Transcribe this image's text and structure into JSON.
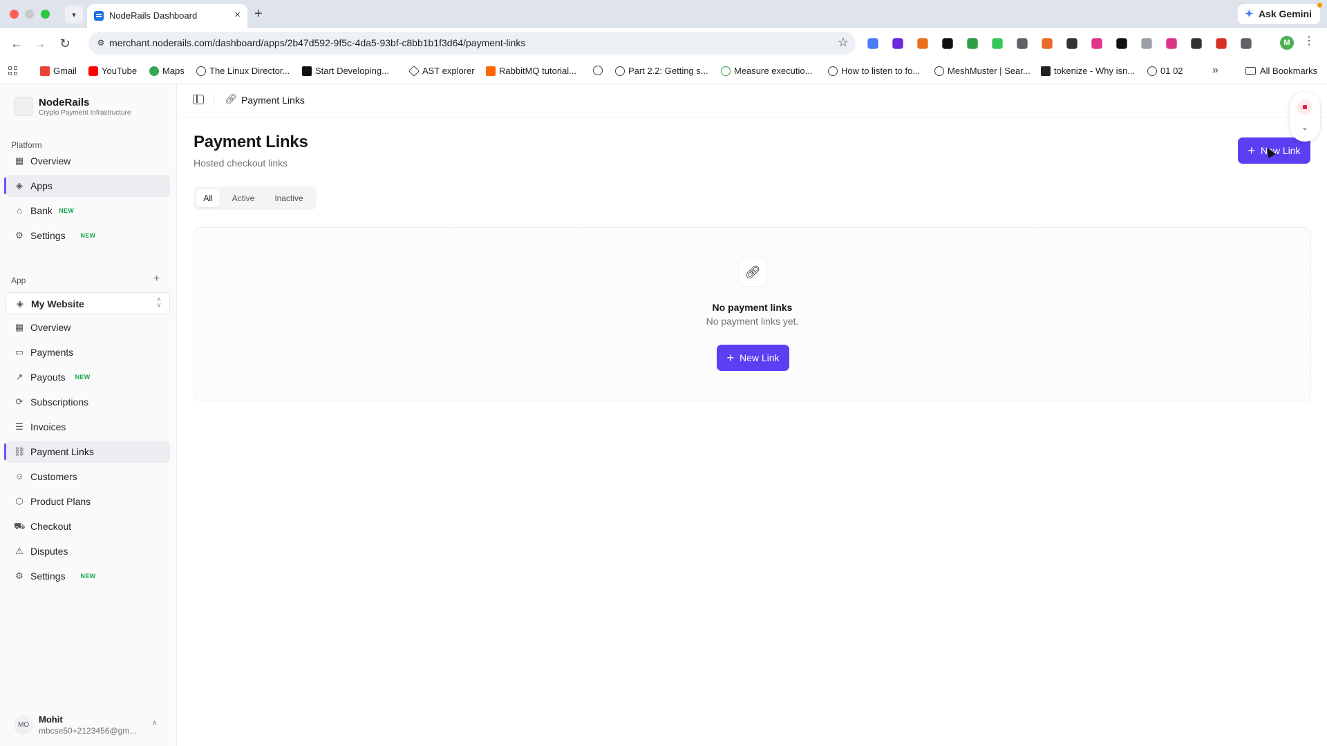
{
  "browser": {
    "tab_title": "NodeRails Dashboard",
    "url": "merchant.noderails.com/dashboard/apps/2b47d592-9f5c-4da5-93bf-c8bb1b1f3d64/payment-links",
    "ask_gemini": "Ask Gemini",
    "profile_initial": "M",
    "bookmarks": [
      "Gmail",
      "YouTube",
      "Maps",
      "The Linux Director...",
      "Start Developing...",
      "AST explorer",
      "RabbitMQ tutorial...",
      "Part 2.2: Getting s...",
      "Measure executio...",
      "How to listen to fo...",
      "MeshMuster | Sear...",
      "tokenize - Why isn...",
      "01 02"
    ],
    "all_bookmarks": "All Bookmarks",
    "extension_colors": [
      "#4a7cf2",
      "#6d28d9",
      "#e8701a",
      "#111111",
      "#2e9e44",
      "#34c759",
      "#5f6368",
      "#e86c2c",
      "#333333",
      "#e0338a",
      "#111111",
      "#9aa0a6",
      "#e0338a",
      "#333333",
      "#d93025",
      "#5f6368"
    ]
  },
  "sidebar": {
    "brand_name": "NodeRails",
    "brand_sub": "Crypto Payment Infrastructure",
    "platform_label": "Platform",
    "platform_items": [
      {
        "label": "Overview",
        "icon": "grid-icon",
        "badge": ""
      },
      {
        "label": "Apps",
        "icon": "layers-icon",
        "badge": "",
        "active": true
      },
      {
        "label": "Bank",
        "icon": "bank-icon",
        "badge": "NEW"
      },
      {
        "label": "Settings",
        "icon": "gear-icon",
        "badge": "NEW"
      }
    ],
    "app_label": "App",
    "app_selector": "My Website",
    "app_items": [
      {
        "label": "Overview",
        "icon": "grid-icon",
        "badge": ""
      },
      {
        "label": "Payments",
        "icon": "credit-card-icon",
        "badge": ""
      },
      {
        "label": "Payouts",
        "icon": "arrow-up-right-icon",
        "badge": "NEW"
      },
      {
        "label": "Subscriptions",
        "icon": "refresh-icon",
        "badge": ""
      },
      {
        "label": "Invoices",
        "icon": "receipt-icon",
        "badge": ""
      },
      {
        "label": "Payment Links",
        "icon": "link-icon",
        "badge": "",
        "active": true
      },
      {
        "label": "Customers",
        "icon": "users-icon",
        "badge": ""
      },
      {
        "label": "Product Plans",
        "icon": "package-icon",
        "badge": ""
      },
      {
        "label": "Checkout",
        "icon": "cart-icon",
        "badge": ""
      },
      {
        "label": "Disputes",
        "icon": "warning-icon",
        "badge": ""
      },
      {
        "label": "Settings",
        "icon": "gear-icon",
        "badge": "NEW"
      }
    ],
    "user": {
      "initials": "MO",
      "name": "Mohit",
      "email": "mbcse50+2123456@gm..."
    }
  },
  "header": {
    "breadcrumb": "Payment Links"
  },
  "page": {
    "title": "Payment Links",
    "subtitle": "Hosted checkout links",
    "new_link_label": "New Link",
    "filters": [
      "All",
      "Active",
      "Inactive"
    ],
    "active_filter": "All",
    "empty_title": "No payment links",
    "empty_sub": "No payment links yet.",
    "empty_button": "New Link"
  },
  "colors": {
    "accent": "#5b3ff2",
    "new_badge": "#16a34a",
    "active_indicator": "#6d55f7"
  }
}
